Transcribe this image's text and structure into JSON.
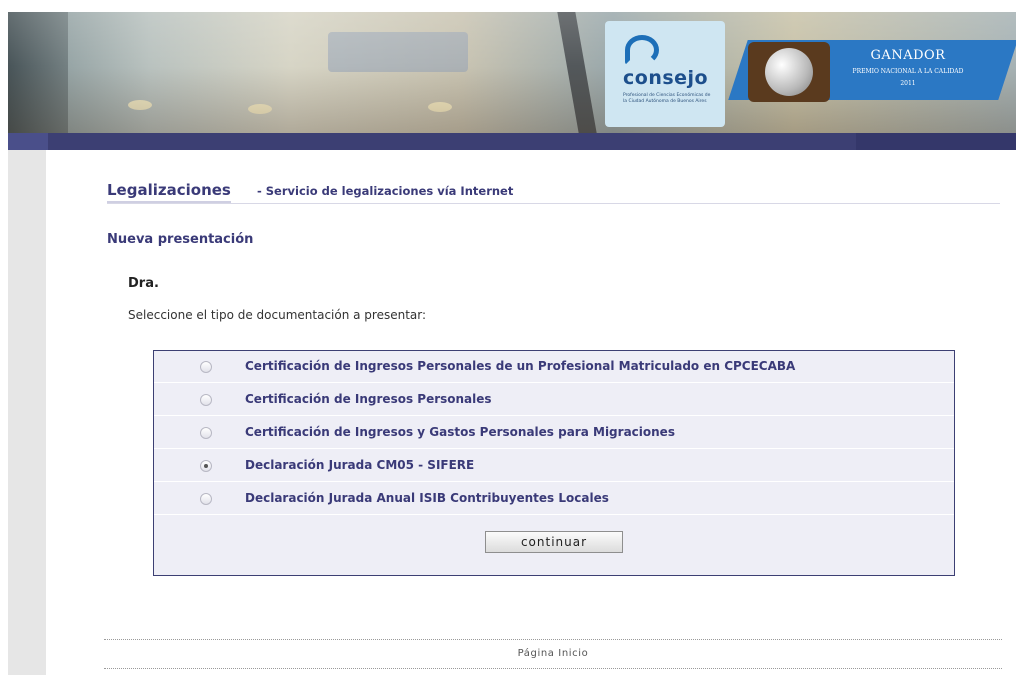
{
  "banner": {
    "logo_text": "consejo",
    "logo_subtext": "Profesional de Ciencias Económicas de la Ciudad Autónoma de Buenos Aires",
    "award_title": "GANADOR",
    "award_subtitle": "PREMIO NACIONAL A LA CALIDAD",
    "award_year": "2011",
    "colors": {
      "navbar": "#3c3f73",
      "award_band": "#2b78c4"
    }
  },
  "header": {
    "title": "Legalizaciones",
    "subtitle": "- Servicio de legalizaciones vía Internet"
  },
  "subsection": "Nueva presentación",
  "doctor": "Dra.",
  "instruction": "Seleccione el tipo de documentación a presentar:",
  "options": [
    {
      "label": "Certificación de Ingresos Personales de un Profesional Matriculado en CPCECABA",
      "checked": false
    },
    {
      "label": "Certificación de Ingresos Personales",
      "checked": false
    },
    {
      "label": "Certificación de Ingresos y Gastos Personales para Migraciones",
      "checked": false
    },
    {
      "label": "Declaración Jurada CM05 - SIFERE",
      "checked": true
    },
    {
      "label": "Declaración Jurada Anual ISIB Contribuyentes Locales",
      "checked": false
    }
  ],
  "continue_label": "continuar",
  "footer": {
    "home_link": "Página Inicio"
  },
  "colors": {
    "primary_text": "#3a3a78",
    "options_bg": "#eeeef6"
  }
}
